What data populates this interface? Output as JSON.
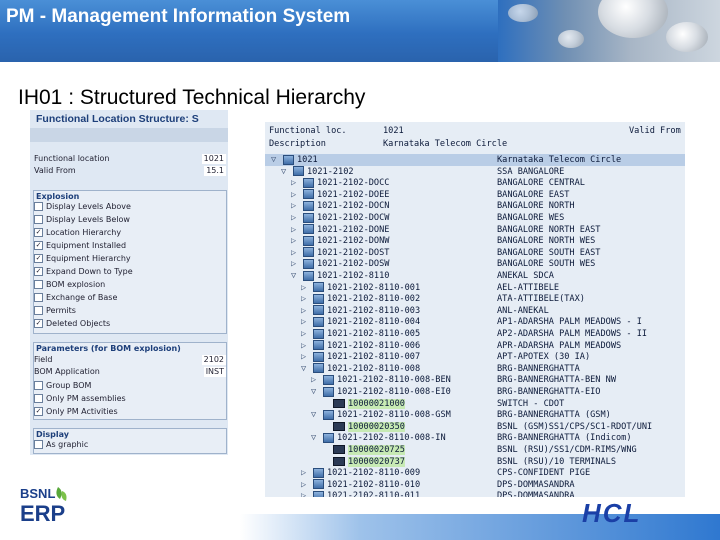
{
  "banner": {
    "title": "PM - Management Information System"
  },
  "slide": {
    "title": "IH01 : Structured Technical Hierarchy"
  },
  "left_panel": {
    "title": "Functional Location Structure: S",
    "fields": [
      {
        "label": "Functional location",
        "value": "1021"
      },
      {
        "label": "Valid From",
        "value": "15.1"
      }
    ],
    "explosion": {
      "header": "Explosion",
      "items": [
        {
          "label": "Display Levels Above",
          "checked": false
        },
        {
          "label": "Display Levels Below",
          "checked": false
        },
        {
          "label": "Location Hierarchy",
          "checked": true
        },
        {
          "label": "Equipment Installed",
          "checked": true
        },
        {
          "label": "Equipment Hierarchy",
          "checked": true
        },
        {
          "label": "Expand Down to Type",
          "checked": true
        },
        {
          "label": "BOM explosion",
          "checked": false
        },
        {
          "label": "Exchange of Base",
          "checked": false
        },
        {
          "label": "Permits",
          "checked": false
        },
        {
          "label": "Deleted Objects",
          "checked": true
        }
      ]
    },
    "bom": {
      "header": "Parameters (for BOM explosion)",
      "fields": [
        {
          "label": "Field",
          "value": "2102"
        },
        {
          "label": "BOM Application",
          "value": "INST"
        }
      ],
      "items": [
        {
          "label": "Group BOM",
          "checked": false
        },
        {
          "label": "Only PM assemblies",
          "checked": false
        },
        {
          "label": "Only PM Activities",
          "checked": true
        }
      ]
    },
    "display": {
      "header": "Display",
      "items": [
        {
          "label": "As graphic",
          "checked": false
        }
      ]
    }
  },
  "tree": {
    "header": {
      "row1": {
        "label": "Functional loc.",
        "value": "1021",
        "right": "Valid From"
      },
      "row2": {
        "label": "Description",
        "value": "Karnataka Telecom Circle"
      }
    },
    "rows": [
      {
        "level": 0,
        "exp": "▽",
        "icon": "folder",
        "id": "1021",
        "desc": "Karnataka Telecom Circle",
        "hl": false,
        "sel": true
      },
      {
        "level": 1,
        "exp": "▽",
        "icon": "folder",
        "id": "1021-2102",
        "desc": "SSA BANGALORE",
        "hl": false,
        "sel": false
      },
      {
        "level": 2,
        "exp": "▷",
        "icon": "folder",
        "id": "1021-2102-DOCC",
        "desc": "BANGALORE CENTRAL",
        "hl": false,
        "sel": false
      },
      {
        "level": 2,
        "exp": "▷",
        "icon": "folder",
        "id": "1021-2102-DOEE",
        "desc": "BANGALORE EAST",
        "hl": false,
        "sel": false
      },
      {
        "level": 2,
        "exp": "▷",
        "icon": "folder",
        "id": "1021-2102-DOCN",
        "desc": "BANGALORE NORTH",
        "hl": false,
        "sel": false
      },
      {
        "level": 2,
        "exp": "▷",
        "icon": "folder",
        "id": "1021-2102-DOCW",
        "desc": "BANGALORE WES",
        "hl": false,
        "sel": false
      },
      {
        "level": 2,
        "exp": "▷",
        "icon": "folder",
        "id": "1021-2102-DONE",
        "desc": "BANGALORE NORTH EAST",
        "hl": false,
        "sel": false
      },
      {
        "level": 2,
        "exp": "▷",
        "icon": "folder",
        "id": "1021-2102-DONW",
        "desc": "BANGALORE NORTH WES",
        "hl": false,
        "sel": false
      },
      {
        "level": 2,
        "exp": "▷",
        "icon": "folder",
        "id": "1021-2102-DOST",
        "desc": "BANGALORE SOUTH EAST",
        "hl": false,
        "sel": false
      },
      {
        "level": 2,
        "exp": "▷",
        "icon": "folder",
        "id": "1021-2102-DOSW",
        "desc": "BANGALORE SOUTH WES",
        "hl": false,
        "sel": false
      },
      {
        "level": 2,
        "exp": "▽",
        "icon": "folder",
        "id": "1021-2102-8110",
        "desc": "ANEKAL SDCA",
        "hl": false,
        "sel": false
      },
      {
        "level": 3,
        "exp": "▷",
        "icon": "folder",
        "id": "1021-2102-8110-001",
        "desc": "AEL-ATTIBELE",
        "hl": false,
        "sel": false
      },
      {
        "level": 3,
        "exp": "▷",
        "icon": "folder",
        "id": "1021-2102-8110-002",
        "desc": "ATA-ATTIBELE(TAX)",
        "hl": false,
        "sel": false
      },
      {
        "level": 3,
        "exp": "▷",
        "icon": "folder",
        "id": "1021-2102-8110-003",
        "desc": "ANL-ANEKAL",
        "hl": false,
        "sel": false
      },
      {
        "level": 3,
        "exp": "▷",
        "icon": "folder",
        "id": "1021-2102-8110-004",
        "desc": "AP1-ADARSHA PALM MEADOWS - I",
        "hl": false,
        "sel": false
      },
      {
        "level": 3,
        "exp": "▷",
        "icon": "folder",
        "id": "1021-2102-8110-005",
        "desc": "AP2-ADARSHA PALM MEADOWS - II",
        "hl": false,
        "sel": false
      },
      {
        "level": 3,
        "exp": "▷",
        "icon": "folder",
        "id": "1021-2102-8110-006",
        "desc": "APR-ADARSHA PALM MEADOWS",
        "hl": false,
        "sel": false
      },
      {
        "level": 3,
        "exp": "▷",
        "icon": "folder",
        "id": "1021-2102-8110-007",
        "desc": "APT-APOTEX (30 IA)",
        "hl": false,
        "sel": false
      },
      {
        "level": 3,
        "exp": "▽",
        "icon": "folder",
        "id": "1021-2102-8110-008",
        "desc": "BRG-BANNERGHATTA",
        "hl": false,
        "sel": false
      },
      {
        "level": 4,
        "exp": "▷",
        "icon": "folder",
        "id": "1021-2102-8110-008-BEN",
        "desc": "BRG-BANNERGHATTA-BEN NW",
        "hl": false,
        "sel": false
      },
      {
        "level": 4,
        "exp": "▽",
        "icon": "folder",
        "id": "1021-2102-8110-008-EI0",
        "desc": "BRG-BANNERGHATTA-EIO",
        "hl": false,
        "sel": false
      },
      {
        "level": 5,
        "exp": "",
        "icon": "equip",
        "id": "10000021000",
        "desc": "SWITCH - CDOT",
        "hl": true,
        "sel": false
      },
      {
        "level": 4,
        "exp": "▽",
        "icon": "folder",
        "id": "1021-2102-8110-008-GSM",
        "desc": "BRG-BANNERGHATTA (GSM)",
        "hl": false,
        "sel": false
      },
      {
        "level": 5,
        "exp": "",
        "icon": "equip",
        "id": "10000020350",
        "desc": "BSNL (GSM)SS1/CPS/SC1-RDOT/UNI",
        "hl": true,
        "sel": false
      },
      {
        "level": 4,
        "exp": "▽",
        "icon": "folder",
        "id": "1021-2102-8110-008-IN",
        "desc": "BRG-BANNERGHATTA (Indicom)",
        "hl": false,
        "sel": false
      },
      {
        "level": 5,
        "exp": "",
        "icon": "equip",
        "id": "10000020725",
        "desc": "BSNL (RSU)/SS1/CDM-RIMS/WNG",
        "hl": true,
        "sel": false
      },
      {
        "level": 5,
        "exp": "",
        "icon": "equip",
        "id": "10000020737",
        "desc": "BSNL (RSU)/10 TERMINALS",
        "hl": true,
        "sel": false
      },
      {
        "level": 3,
        "exp": "▷",
        "icon": "folder",
        "id": "1021-2102-8110-009",
        "desc": "CPS-CONFIDENT PIGE",
        "hl": false,
        "sel": false
      },
      {
        "level": 3,
        "exp": "▷",
        "icon": "folder",
        "id": "1021-2102-8110-010",
        "desc": "DPS-DOMMASANDRA",
        "hl": false,
        "sel": false
      },
      {
        "level": 3,
        "exp": "▷",
        "icon": "folder",
        "id": "1021-2102-8110-011",
        "desc": "DPS-DOMMASANDRA",
        "hl": false,
        "sel": false
      }
    ]
  },
  "logos": {
    "left_top": "BSNL",
    "left_bottom": "ERP",
    "right": "HCL"
  },
  "colors": {
    "banner": "#2e6fbf",
    "highlight": "#c7eab4",
    "panel": "#e6edf5",
    "hcl": "#1a3fa6"
  }
}
